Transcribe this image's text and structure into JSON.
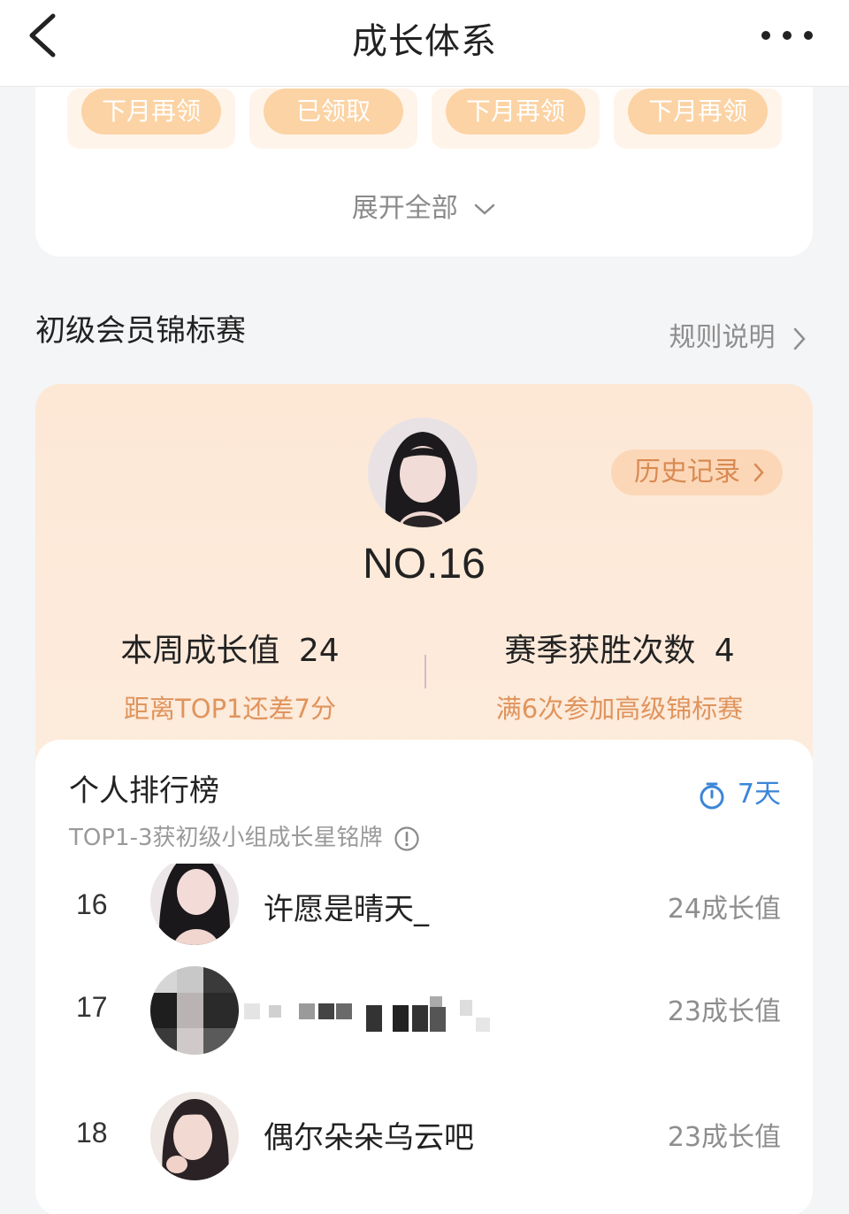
{
  "navbar": {
    "title": "成长体系"
  },
  "rewards": [
    {
      "label": "下月再领"
    },
    {
      "label": "已领取"
    },
    {
      "label": "下月再领"
    },
    {
      "label": "下月再领"
    }
  ],
  "expand_label": "展开全部",
  "section": {
    "title": "初级会员锦标赛",
    "rules_label": "规则说明"
  },
  "tournament": {
    "history_label": "历史记录",
    "rank": "NO.16",
    "weekly_growth_label": "本周成长值",
    "weekly_growth_value": "24",
    "gap_text": "距离TOP1还差7分",
    "season_wins_label": "赛季获胜次数",
    "season_wins_value": "4",
    "advance_text": "满6次参加高级锦标赛"
  },
  "ranking": {
    "title": "个人排行榜",
    "timer": "7天",
    "note": "TOP1-3获初级小组成长星铭牌",
    "rows": [
      {
        "rank": "16",
        "name": "许愿是晴天_",
        "score": "24成长值"
      },
      {
        "rank": "17",
        "name": "",
        "score": "23成长值"
      },
      {
        "rank": "18",
        "name": "偶尔朵朵乌云吧",
        "score": "23成长值"
      }
    ]
  },
  "colors": {
    "accent_orange": "#e0945c",
    "timer_blue": "#3b86d8",
    "reward_button": "#fbd3a4"
  }
}
